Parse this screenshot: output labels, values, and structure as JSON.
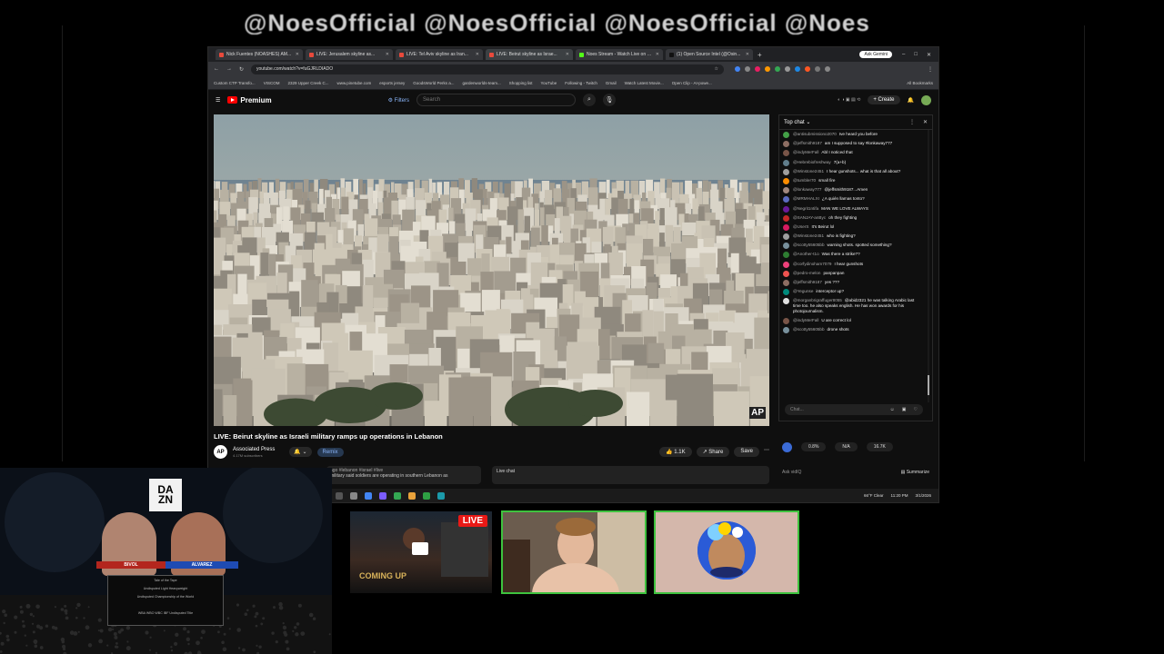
{
  "overlay": {
    "ticker_text": "@NoesOfficial @NoesOfficial @NoesOfficial @Noes"
  },
  "browser": {
    "tabs": [
      {
        "label": "Nick Fuentes (NOASHES) AM...",
        "color": "#e84a3c",
        "active": false
      },
      {
        "label": "LIVE: Jerusalem skyline as...",
        "color": "#e84a3c",
        "active": false
      },
      {
        "label": "LIVE: Tel Aviv skyline as Iran...",
        "color": "#e84a3c",
        "active": false
      },
      {
        "label": "LIVE: Beirut skyline as Israe...",
        "color": "#e84a3c",
        "active": true
      },
      {
        "label": "Noes Stream - Watch Live on K...",
        "color": "#53fc18",
        "active": false
      },
      {
        "label": "(1) Open Source Intel (@Osin...",
        "color": "#111111",
        "active": false
      }
    ],
    "ask_gemini": "Ask Gemini",
    "url": "youtube.com/watch?v=fuGJRLDIADO",
    "bookmarks": [
      "Custom CTP Transfo...",
      "VISCOM",
      "2329 Upper Creek C...",
      "www.pinetube.com",
      "esports jersey",
      "GoodsWorld Perks a...",
      "gardenworlds-team...",
      "Shopping list",
      "YouTube",
      "Following - Twitch",
      "Gmail",
      "Watch Latest Movie...",
      "Open Clip - AI-powe..."
    ],
    "all_bookmarks": "All Bookmarks"
  },
  "youtube": {
    "logo": "Premium",
    "filters": "Filters",
    "search_placeholder": "Search",
    "create": "+ Create",
    "video_title": "LIVE: Beirut skyline as Israeli military ramps up operations in Lebanon",
    "channel_name": "Associated Press",
    "subscribers": "4.17M subscribers",
    "bell": "🔔 ⌄",
    "remix": "Remix",
    "likes": "👍 1.1K",
    "share": "↗ Share",
    "save": "Save",
    "ap_badge": "AP",
    "desc_tags": "ago #lebanon #israel #live",
    "desc_text": "military said soldiers are operating in southern Lebanon as",
    "live_chat_label": "Live chat"
  },
  "chat": {
    "header": "Top chat",
    "messages": [
      {
        "user": "@antisubmissiono2070",
        "text": "Ive heard you before",
        "color": "#43a047"
      },
      {
        "user": "@jeffsmith9187",
        "text": "am I supposed to say #lonkaway777",
        "color": "#8d6e63"
      },
      {
        "user": "@indyMerFall",
        "text": "Abl I noticed that",
        "color": "#795548"
      },
      {
        "user": "@Hebrebiofreshway",
        "text": "7(a+b)",
        "color": "#607d8b"
      },
      {
        "user": "@Winstone2451",
        "text": "I hear gunshots... what is that all about?",
        "color": "#9e9e9e"
      },
      {
        "user": "@tumbler70",
        "text": "small fire",
        "color": "#fb8c00"
      },
      {
        "user": "@lonkaway777",
        "text": "@jeffsmith9187...Amen",
        "color": "#a1887f"
      },
      {
        "user": "@MRMHALXI",
        "text": "¿A quién llamas tonto?",
        "color": "#5c6bc0"
      },
      {
        "user": "@Negrit1ntifa",
        "text": "MAN WE LOVE ALWAYS",
        "color": "#6a1b9a"
      },
      {
        "user": "@SANJAY-anByc",
        "text": "oh they fighting",
        "color": "#c62828"
      },
      {
        "user": "@UserS",
        "text": "It's Beirut lol",
        "color": "#d81b60"
      },
      {
        "user": "@Winstone2451",
        "text": "who is fighting?",
        "color": "#9e9e9e"
      },
      {
        "user": "@scotty55605bb",
        "text": "warning shots. spotted something?",
        "color": "#78909c"
      },
      {
        "user": "@Another-t1o",
        "text": "Was there a strike??",
        "color": "#2e7d32"
      },
      {
        "user": "@corfydinoham7079",
        "text": "I hear gunshots",
        "color": "#ec407a"
      },
      {
        "user": "@pedro-melon",
        "text": "panpanpan",
        "color": "#ef5350"
      },
      {
        "user": "@jeffsmith9187",
        "text": "yes ???",
        "color": "#8d6e63"
      },
      {
        "user": "@Yegunse",
        "text": "interceptor up?",
        "color": "#00897b"
      },
      {
        "user": "@morganbrigraffuger8055",
        "text": "@abid2321 he was talking Arabic last time too. he also speaks english. He has won awards for his photojournalism.",
        "color": "#e0e0e0"
      },
      {
        "user": "@indyMerFall",
        "text": "U are correct lol",
        "color": "#795548"
      },
      {
        "user": "@scotty55605bb",
        "text": "drone shots",
        "color": "#78909c"
      }
    ],
    "input_placeholder": "Chat...",
    "poll": [
      "0.8%",
      "N/A",
      "16.7K"
    ],
    "ask_placeholder": "Ask vidIQ",
    "summarize": "Summarize"
  },
  "taskbar": {
    "weather": "66°F Clear",
    "time": "11:20 PM",
    "date": "3/1/2026"
  },
  "boxing": {
    "brand": "DAZN",
    "fighter_left": "BIVOL",
    "fighter_right": "ALVAREZ",
    "tale_rows": [
      "Tale of the Tape",
      "Undisputed Light Heavyweight",
      "Undisputed Championship of the World",
      "",
      "WBA WBO WBC IBF Undisputed Title"
    ]
  },
  "cams": {
    "live_badge": "LIVE",
    "coming_up": "COMING UP"
  }
}
